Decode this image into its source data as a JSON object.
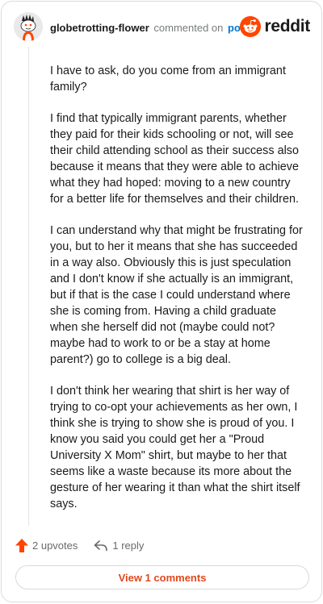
{
  "header": {
    "username": "globetrotting-flower",
    "commented_text": "commented on",
    "post_link": "post",
    "brand": "reddit"
  },
  "comment": {
    "paragraphs": [
      "I have to ask, do you come from an immigrant family?",
      "I find that typically immigrant parents, whether they paid for their kids schooling or not, will see their child attending school as their success also because it means that they were able to achieve what they had hoped: moving to a new country for a better life for themselves and their children.",
      "I can understand why that might be frustrating for you, but to her it means that she has succeeded in a way also. Obviously this is just speculation and I don't know if she actually is an immigrant, but if that is the case I could understand where she is coming from. Having a child graduate when she herself did not (maybe could not? maybe had to work to or be a stay at home parent?) go to college is a big deal.",
      "I don't think her wearing that shirt is her way of trying to co-opt your achievements as her own, I think she is trying to show she is proud of you. I know you said you could get her a \"Proud University X Mom\" shirt, but maybe to her that seems like a waste because its more about the gesture of her wearing it than what the shirt itself says."
    ]
  },
  "footer": {
    "upvotes": "2 upvotes",
    "replies": "1 reply",
    "view_comments": "View 1 comments"
  },
  "colors": {
    "upvote_arrow": "#ff4500",
    "link_blue": "#0079d3",
    "view_button_text": "#e0481c",
    "reddit_orange": "#ff4500"
  },
  "icons": {
    "avatar": "snoo-avatar-icon",
    "logo": "reddit-snoo-icon",
    "upvote": "upvote-arrow-icon",
    "reply": "reply-arrow-icon"
  }
}
